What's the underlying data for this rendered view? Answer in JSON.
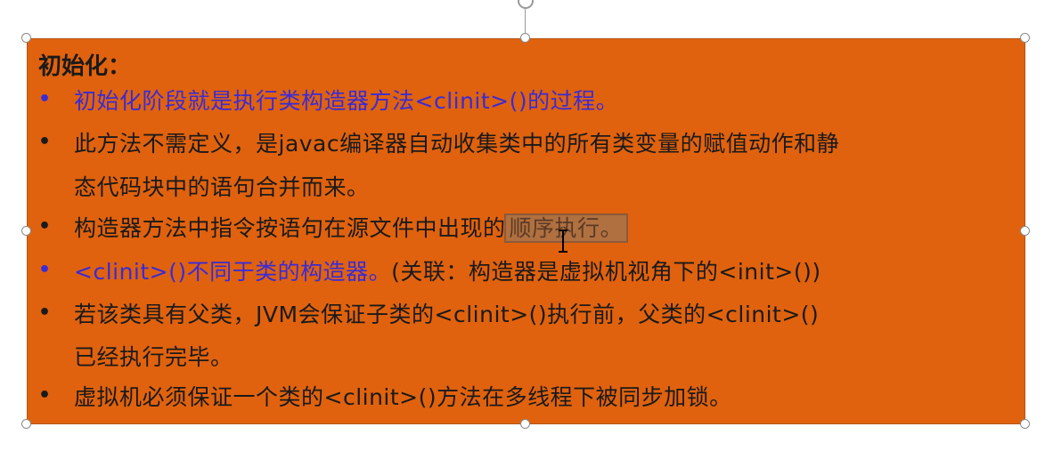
{
  "slide": {
    "heading": "初始化：",
    "bullet_char": "•",
    "colors": {
      "box_fill": "#e0620e",
      "text_dark": "#1a1a1a",
      "text_blue": "#3a2bd6",
      "selection_fill": "#b0703f"
    },
    "bullets": [
      {
        "color": "blue",
        "lines": [
          "初始化阶段就是执行类构造器方法<clinit>()的过程。"
        ]
      },
      {
        "color": "dark",
        "lines": [
          "此方法不需定义，是javac编译器自动收集类中的所有类变量的赋值动作和静",
          "态代码块中的语句合并而来。"
        ]
      },
      {
        "color": "dark",
        "pre_selection": "构造器方法中指令按语句在源文件中出现的",
        "selected_text": "顺序执行。"
      },
      {
        "color": "mixed",
        "blue_part": "<clinit>()不同于类的构造器。",
        "dark_part": "(关联：构造器是虚拟机视角下的<init>())"
      },
      {
        "color": "dark",
        "lines": [
          "若该类具有父类，JVM会保证子类的<clinit>()执行前，父类的<clinit>()",
          "已经执行完毕。"
        ]
      },
      {
        "color": "dark",
        "lines": [
          "虚拟机必须保证一个类的<clinit>()方法在多线程下被同步加锁。"
        ]
      }
    ]
  },
  "cursor": "text-ibeam-cursor"
}
